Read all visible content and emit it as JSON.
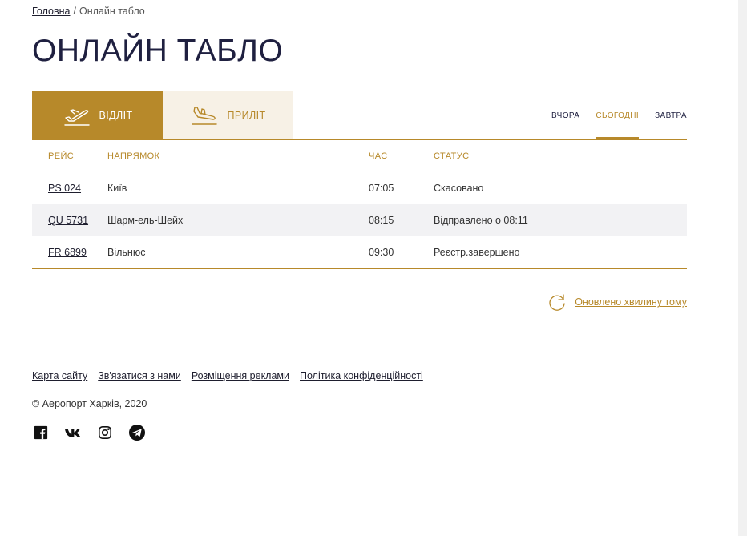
{
  "breadcrumb": {
    "home": "Головна",
    "separator": "/",
    "current": "Онлайн табло"
  },
  "page_title": "ОНЛАЙН ТАБЛО",
  "tabs": [
    {
      "label": "ВІДЛІТ",
      "icon": "departure-plane-icon",
      "active": true
    },
    {
      "label": "ПРИЛІТ",
      "icon": "arrival-plane-icon",
      "active": false
    }
  ],
  "days": [
    {
      "label": "ВЧОРА",
      "active": false
    },
    {
      "label": "СЬОГОДНІ",
      "active": true
    },
    {
      "label": "ЗАВТРА",
      "active": false
    }
  ],
  "table": {
    "headers": [
      "РЕЙС",
      "НАПРЯМОК",
      "ЧАС",
      "СТАТУС"
    ],
    "rows": [
      {
        "flight": "PS 024",
        "direction": "Київ",
        "time": "07:05",
        "status": "Скасовано"
      },
      {
        "flight": "QU 5731",
        "direction": "Шарм-ель-Шейх",
        "time": "08:15",
        "status": "Відправлено о 08:11"
      },
      {
        "flight": "FR 6899",
        "direction": "Вільнюс",
        "time": "09:30",
        "status": "Реєстр.завершено"
      }
    ]
  },
  "refresh": {
    "label": "Оновлено хвилину тому",
    "icon": "refresh-icon"
  },
  "footer": {
    "links": [
      "Карта сайту",
      "Зв'язатися з нами",
      "Розміщення реклами",
      "Політика конфіденційності"
    ],
    "copyright": "© Аеропорт Харків, 2020",
    "social": [
      "facebook-icon",
      "vk-icon",
      "instagram-icon",
      "telegram-icon"
    ]
  },
  "colors": {
    "accent": "#b7892a",
    "accent_light": "#f7f1e6",
    "title": "#1f2040",
    "row_alt": "#f2f2f4"
  }
}
